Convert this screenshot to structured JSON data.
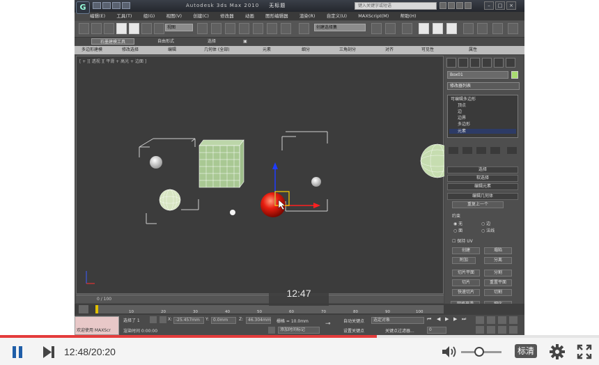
{
  "app": {
    "title": "Autodesk 3ds Max   2010",
    "document": "无标题",
    "help_search_placeholder": "键入关键字或短语",
    "menu": [
      "编辑(E)",
      "工具(T)",
      "组(G)",
      "视图(V)",
      "创建(C)",
      "修改器",
      "动画",
      "图形编辑器",
      "渲染(R)",
      "自定义(U)",
      "MAXScript(M)",
      "帮助(H)"
    ],
    "toolbar": {
      "selection_filter": "视图",
      "named_selection": "创建选择集"
    },
    "ribbon_tabs": [
      "石墨建模工具",
      "自由形式",
      "选择",
      "▣"
    ],
    "ribbon_sub": [
      "多边形建模",
      "修改选择",
      "编辑",
      "几何体 (全部)",
      "元素",
      "细分",
      "三角剖分",
      "对齐",
      "可见性",
      "属性"
    ],
    "viewport_label": "[ + ][ 透视 ][ 平滑 + 高光 + 边面 ]",
    "command_panel": {
      "object_name": "Box01",
      "modifier_list": "修改器列表",
      "stack": [
        {
          "label": "可编辑多边形",
          "selected": false
        },
        {
          "label": "顶点",
          "selected": false
        },
        {
          "label": "边",
          "selected": false
        },
        {
          "label": "边界",
          "selected": false
        },
        {
          "label": "多边形",
          "selected": false
        },
        {
          "label": "元素",
          "selected": true
        }
      ],
      "rollouts": [
        "选择",
        "软选择",
        "编辑元素",
        "编辑几何体"
      ],
      "repeat_last": "重复上一个",
      "constraints_label": "约束",
      "constraint_options": [
        "无",
        "边",
        "面",
        "法线"
      ],
      "preserve_uv": "保持 UV",
      "buttons": {
        "create": "创建",
        "collapse": "塌陷",
        "attach": "附加",
        "detach": "分离",
        "slice_plane": "切片平面",
        "split": "分割",
        "slice": "切片",
        "reset_plane": "重置平面",
        "quickslice": "快速切片",
        "cut": "切割",
        "meshsmooth": "网格平滑",
        "tessellate": "细化"
      }
    },
    "time_slider": "0 / 100",
    "timeline_ticks": [
      "10",
      "20",
      "30",
      "40",
      "50",
      "60",
      "70",
      "80",
      "90",
      "100"
    ],
    "status": {
      "welcome": "欢迎使用 MAXScr",
      "selected": "选择了 1",
      "x_value": "-25.457mm",
      "y_value": "0.0mm",
      "z_value": "46.304mm",
      "grid": "栅格 = 10.0mm",
      "auto_key": "自动关键点",
      "selected_obj": "选定对象",
      "set_key": "设置关键点",
      "key_filters": "关键点过滤器...",
      "render_time": "渲染时间 0:00:00",
      "add_time_tag": "添加时间标记",
      "frame": "0"
    }
  },
  "overlay_time": "12:47",
  "player": {
    "time": "12:48/20:20",
    "progress": 0.629,
    "volume": 0.45,
    "quality": "标清"
  }
}
